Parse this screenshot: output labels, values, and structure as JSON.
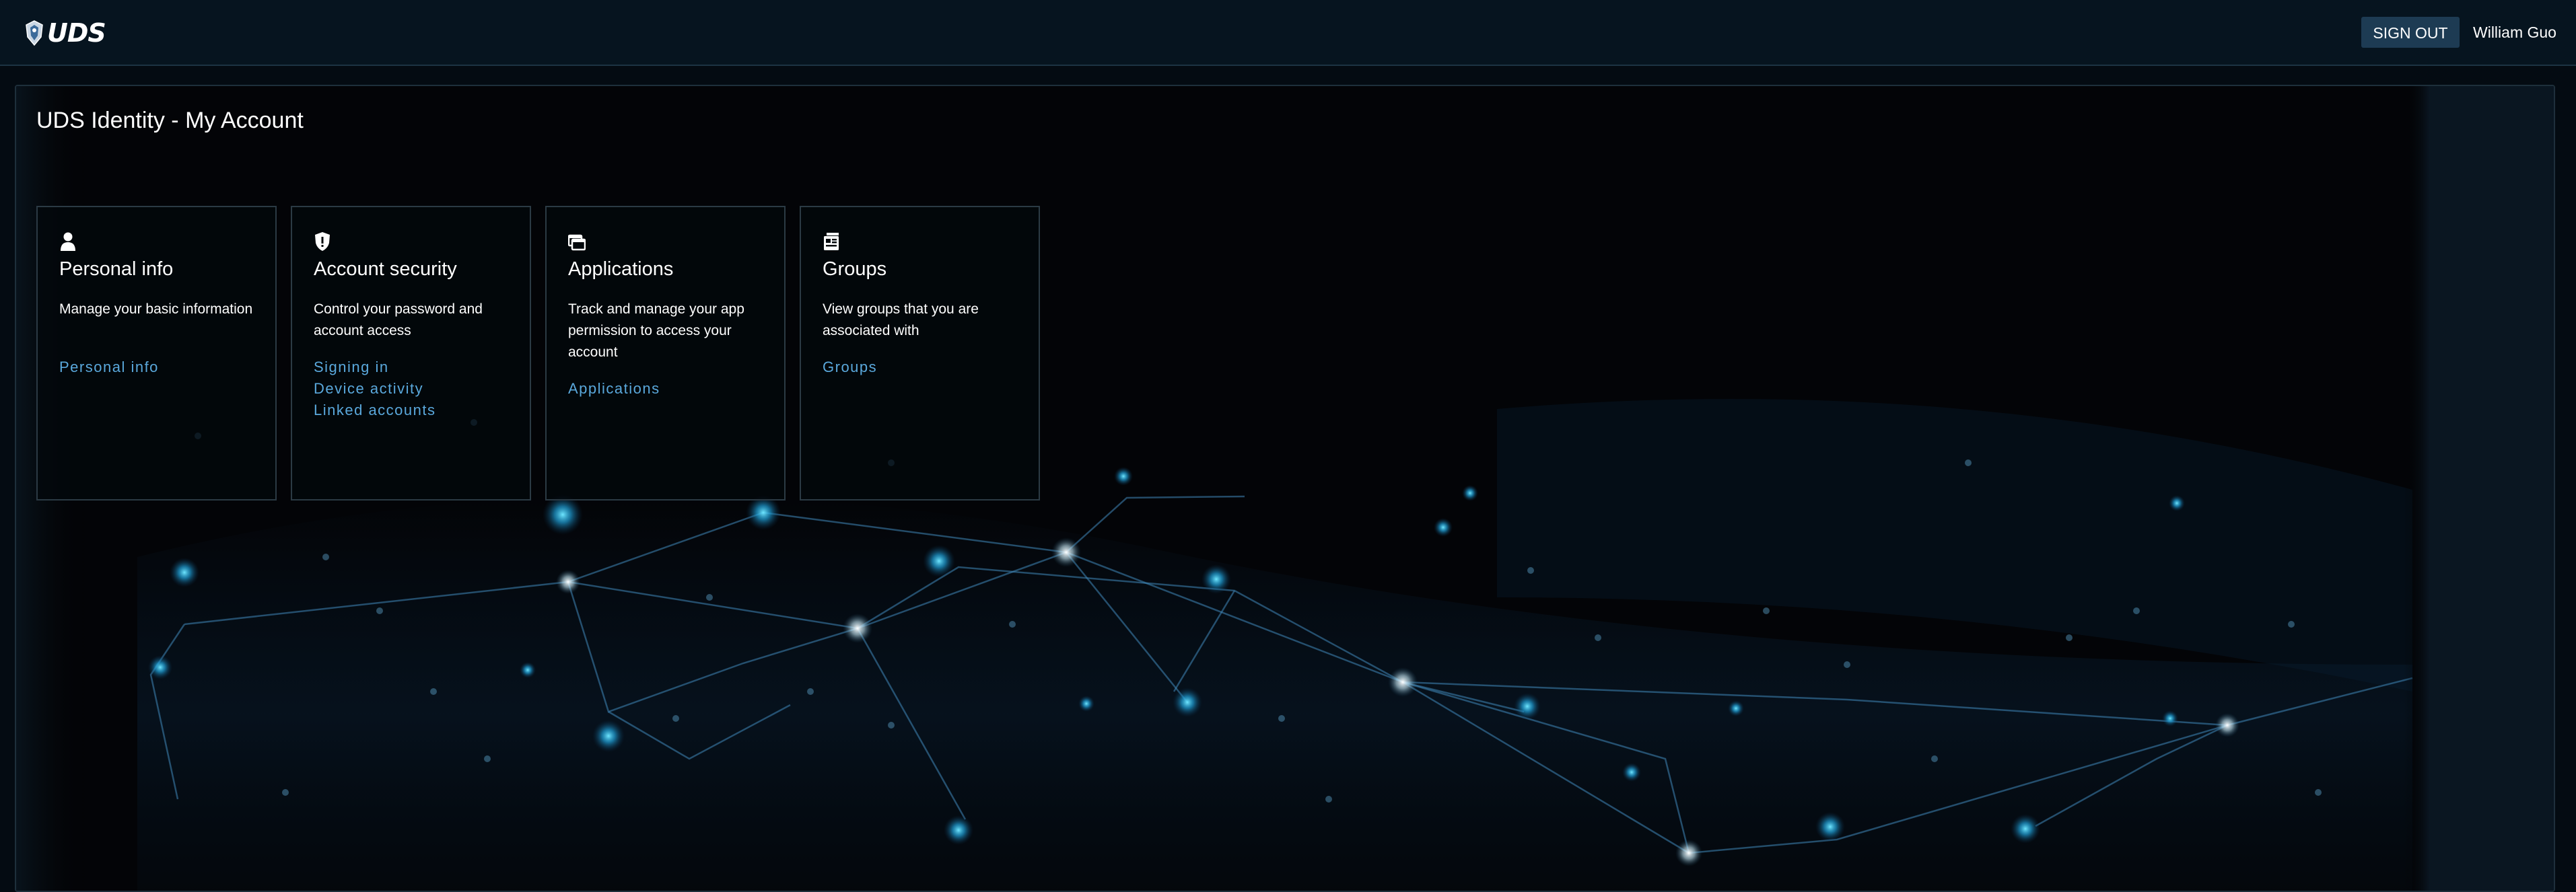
{
  "header": {
    "logo_text": "UDS",
    "sign_out_label": "SIGN OUT",
    "user_name": "William Guo"
  },
  "main": {
    "title": "UDS Identity - My Account",
    "cards": [
      {
        "icon": "user-icon",
        "title": "Personal info",
        "description": "Manage your basic information",
        "links": [
          "Personal info"
        ]
      },
      {
        "icon": "shield-icon",
        "title": "Account security",
        "description": "Control your password and account access",
        "links": [
          "Signing in",
          "Device activity",
          "Linked accounts"
        ]
      },
      {
        "icon": "applications-icon",
        "title": "Applications",
        "description": "Track and manage your app permission to access your account",
        "links": [
          "Applications"
        ]
      },
      {
        "icon": "groups-icon",
        "title": "Groups",
        "description": "View groups that you are associated with",
        "links": [
          "Groups"
        ]
      }
    ]
  },
  "colors": {
    "background": "#040b12",
    "topbar": "#06141f",
    "button": "#1d3b53",
    "link": "#5aa8dc",
    "card_border": "#2b3a44"
  }
}
